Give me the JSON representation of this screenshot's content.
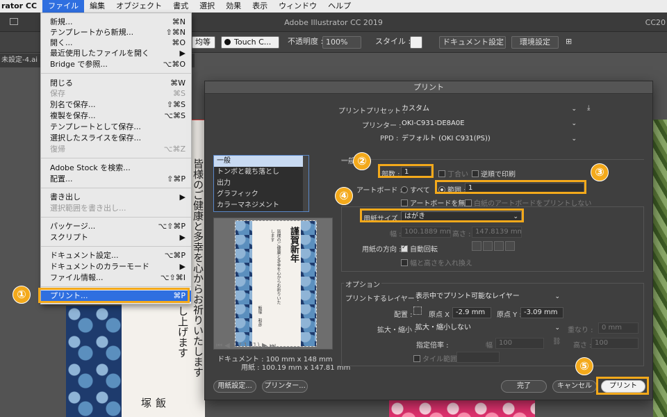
{
  "menubar": {
    "app": "rator CC",
    "items": [
      "ファイル",
      "編集",
      "オブジェクト",
      "書式",
      "選択",
      "効果",
      "表示",
      "ウィンドウ",
      "ヘルプ"
    ]
  },
  "window": {
    "title": "Adobe Illustrator CC 2019",
    "right_fragment": "CC20"
  },
  "control_bar": {
    "stroke_profile": "均等",
    "brush": "Touch C...",
    "opacity_label": "不透明度 :",
    "opacity_value": "100%",
    "style_label": "スタイル :",
    "doc_setup": "ドキュメント設定",
    "preferences": "環境設定"
  },
  "doc_tab": "未設定-4.ai @",
  "file_menu": {
    "items": [
      {
        "label": "新規...",
        "shortcut": "⌘N"
      },
      {
        "label": "テンプレートから新規...",
        "shortcut": "⇧⌘N"
      },
      {
        "label": "開く...",
        "shortcut": "⌘O"
      },
      {
        "label": "最近使用したファイルを開く",
        "shortcut": "▶"
      },
      {
        "label": "Bridge で参照...",
        "shortcut": "⌥⌘O"
      },
      {
        "label": "閉じる",
        "shortcut": "⌘W"
      },
      {
        "label": "保存",
        "shortcut": "⌘S"
      },
      {
        "label": "別名で保存...",
        "shortcut": "⇧⌘S"
      },
      {
        "label": "複製を保存...",
        "shortcut": "⌥⌘S"
      },
      {
        "label": "テンプレートとして保存...",
        "shortcut": ""
      },
      {
        "label": "選択したスライスを保存...",
        "shortcut": ""
      },
      {
        "label": "復帰",
        "shortcut": "⌥⌘Z"
      },
      {
        "label": "Adobe Stock を検索...",
        "shortcut": ""
      },
      {
        "label": "配置...",
        "shortcut": "⇧⌘P"
      },
      {
        "label": "書き出し",
        "shortcut": "▶"
      },
      {
        "label": "選択範囲を書き出し...",
        "shortcut": ""
      },
      {
        "label": "パッケージ...",
        "shortcut": "⌥⇧⌘P"
      },
      {
        "label": "スクリプト",
        "shortcut": "▶"
      },
      {
        "label": "ドキュメント設定...",
        "shortcut": "⌥⌘P"
      },
      {
        "label": "ドキュメントのカラーモード",
        "shortcut": "▶"
      },
      {
        "label": "ファイル情報...",
        "shortcut": "⌥⇧⌘I"
      },
      {
        "label": "プリント...",
        "shortcut": "⌘P"
      }
    ]
  },
  "artwork": {
    "col1": "皆様のご健康と多幸を心からお祈りいたします",
    "col2": "し上げます",
    "col3": "飯塚"
  },
  "print_dialog": {
    "title": "プリント",
    "preset_label": "プリントプリセット :",
    "preset_value": "カスタム",
    "printer_label": "プリンター :",
    "printer_value": "OKI-C931-DE8A0E",
    "ppd_label": "PPD :",
    "ppd_value": "デフォルト (OKI C931(PS))",
    "section_general": "一般",
    "categories": [
      "一般",
      "トンボと裁ち落とし",
      "出力",
      "グラフィック",
      "カラーマネジメント"
    ],
    "copies_label": "部数 :",
    "copies_value": "1",
    "collate": "丁合い",
    "reverse": "逆順で印刷",
    "artboard_label": "アートボード :",
    "all": "すべて",
    "range_label": "範囲 :",
    "range_value": "1",
    "ignore_artboards": "アートボードを無視",
    "skip_blank": "白紙のアートボードをプリントしない",
    "paper_size_label": "用紙サイズ :",
    "paper_size_value": "はがき",
    "width_label": "幅 :",
    "width_value": "100.1889 mm",
    "height_label": "高さ :",
    "height_value": "147.8139 mm",
    "orientation_label": "用紙の方向 :",
    "auto_rotate": "自動回転",
    "swap": "幅と高さを入れ換え",
    "options_title": "オプション",
    "layers_label": "プリントするレイヤー :",
    "layers_value": "表示中でプリント可能なレイヤー",
    "placement_label": "配置 :",
    "origin_x_label": "原点 X :",
    "origin_x_value": "-2.9 mm",
    "origin_y_label": "原点 Y :",
    "origin_y_value": "-3.09 mm",
    "scaling_label": "拡大・縮小 :",
    "scaling_value": "拡大・縮小しない",
    "overlap_label": "重なり :",
    "overlap_value": "0 mm",
    "scale_ratio_label": "指定倍率 :",
    "scale_w_label": "幅 :",
    "scale_w_value": "100",
    "scale_h_label": "高さ :",
    "scale_h_value": "100",
    "tile_range": "タイル範囲 :",
    "page_nav": "1 / 1 (1)",
    "doc_size": "ドキュメント : 100 mm x 148 mm",
    "paper_size": "用紙 : 100.19 mm x 147.81 mm",
    "card_title": "謹賀新年",
    "card_line": "皆様のご健康と多幸を心からお祈りいたします",
    "card_name": "飯塚　和彦",
    "btn_page_setup": "用紙設定...",
    "btn_printer": "プリンター...",
    "btn_done": "完了",
    "btn_cancel": "キャンセル",
    "btn_print": "プリント"
  },
  "steps": [
    "①",
    "②",
    "③",
    "④",
    "⑤"
  ],
  "colors": {
    "accent": "#f3a91b",
    "menu_highlight": "#2f6fe0"
  }
}
